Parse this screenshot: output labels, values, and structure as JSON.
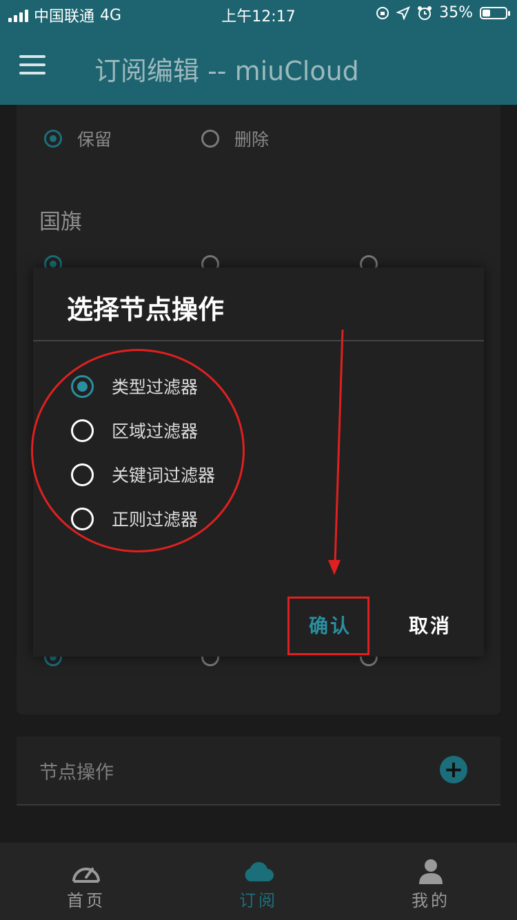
{
  "status_bar": {
    "carrier": "中国联通",
    "network": "4G",
    "time": "上午12:17",
    "battery": "35%",
    "battery_level": 0.35
  },
  "app_bar": {
    "title": "订阅编辑 -- miuCloud",
    "menu_icon": "hamburger-menu-icon"
  },
  "background_form": {
    "row1": {
      "options": [
        "保留",
        "删除"
      ],
      "selected": "保留"
    },
    "flag_section": {
      "label": "国旗"
    },
    "row_bottom": {
      "selected_index": 0
    }
  },
  "dialog": {
    "title": "选择节点操作",
    "options": [
      "类型过滤器",
      "区域过滤器",
      "关键词过滤器",
      "正则过滤器"
    ],
    "selected": "类型过滤器",
    "confirm_label": "确认",
    "cancel_label": "取消"
  },
  "node_ops": {
    "label": "节点操作",
    "add_icon": "plus-icon"
  },
  "bottom_nav": {
    "items": [
      {
        "label": "首页",
        "icon": "speedometer-icon",
        "active": false
      },
      {
        "label": "订阅",
        "icon": "cloud-icon",
        "active": true
      },
      {
        "label": "我的",
        "icon": "person-icon",
        "active": false
      }
    ]
  },
  "colors": {
    "accent": "#1d6470",
    "radio_accent": "#2a8fa0",
    "annotation": "#e02020"
  }
}
